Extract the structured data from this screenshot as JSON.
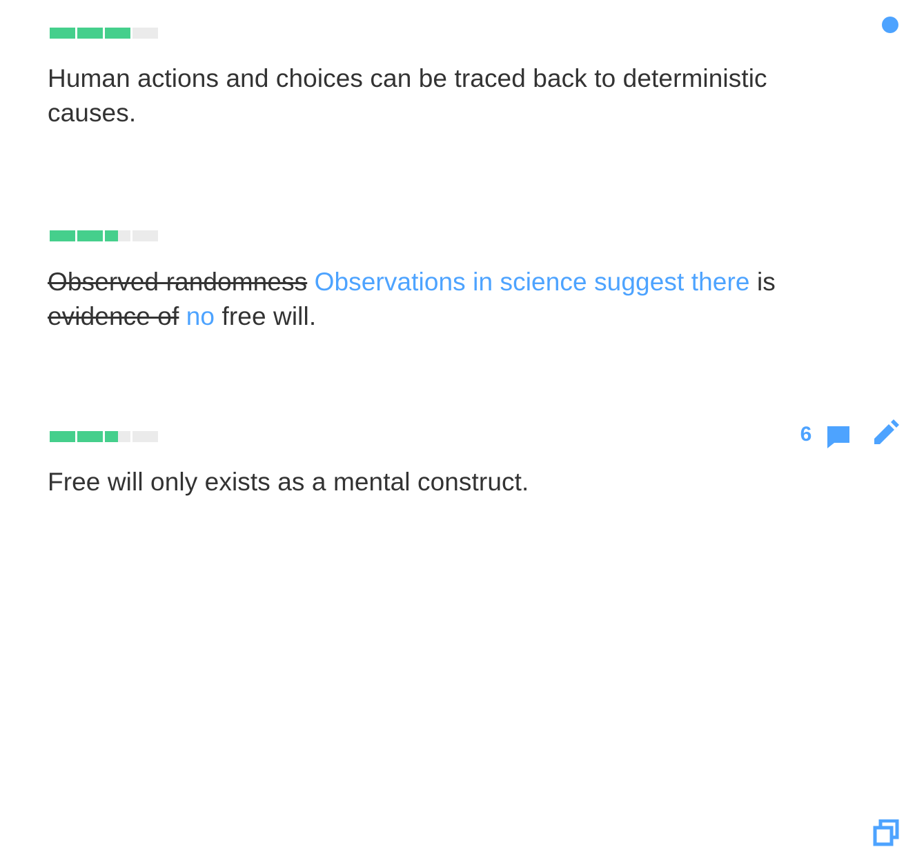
{
  "claims": [
    {
      "meter_fill": 0.75,
      "text": "Human actions and choices can be traced back to deterministic causes.",
      "unread_indicator": true
    },
    {
      "meter_fill": 0.625,
      "comment_count": "6",
      "edit": {
        "removed_1": "Observed randomness",
        "added_1": "Observations in science suggest there",
        "plain_1": "is",
        "removed_2": "evidence of",
        "added_2": "no",
        "plain_2": "free will."
      },
      "icons": [
        "comment-icon",
        "edit-pencil-icon"
      ]
    },
    {
      "meter_fill": 0.625,
      "text": "Free will only exists as a mental construct.",
      "icons": [
        "duplicate-icon"
      ]
    }
  ],
  "colors": {
    "meter_filled": "#45cf8c",
    "meter_empty": "#ebebeb",
    "accent": "#4da3ff",
    "text": "#333333"
  }
}
